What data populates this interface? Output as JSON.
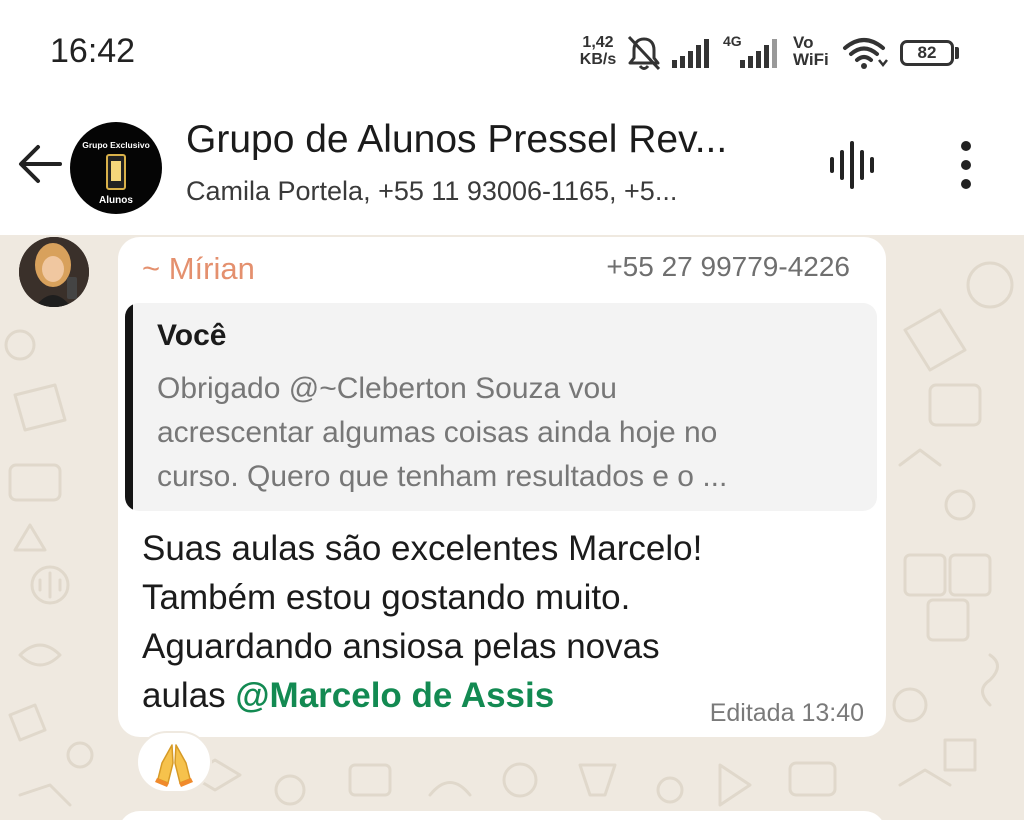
{
  "status_bar": {
    "time": "16:42",
    "net_speed_value": "1,42",
    "net_speed_unit": "KB/s",
    "network_label": "4G",
    "vowifi_line1": "Vo",
    "vowifi_line2": "WiFi",
    "battery_level": "82",
    "icons": [
      "bell-muted-icon",
      "signal-icon",
      "signal-4g-icon",
      "wifi-icon",
      "battery-icon"
    ]
  },
  "header": {
    "title": "Grupo de Alunos Pressel Rev...",
    "subtitle": "Camila Portela, +55 11 93006-1165, +5...",
    "avatar_top_text": "Grupo Exclusivo",
    "avatar_bottom_text": "Alunos",
    "icons": [
      "back-arrow-icon",
      "voice-chat-icon",
      "more-vert-icon"
    ]
  },
  "message": {
    "sender_name": "~ Mírian",
    "sender_phone": "+55 27 99779-4226",
    "quoted": {
      "author": "Você",
      "lines": [
        "Obrigado @~Cleberton Souza vou",
        "acrescentar algumas coisas ainda hoje no",
        "curso. Quero que tenham resultados e o ..."
      ]
    },
    "body_lines": [
      "Suas aulas são excelentes Marcelo!",
      "Também estou gostando muito.",
      "Aguardando ansiosa pelas novas"
    ],
    "body_last_prefix": "aulas ",
    "mention": "@Marcelo de Assis",
    "meta": "Editada 13:40",
    "reaction": "🙏"
  },
  "colors": {
    "chat_background": "#efe9e0",
    "sender_name": "#e4906e",
    "mention": "#138a52",
    "quote_bar": "#141414"
  }
}
